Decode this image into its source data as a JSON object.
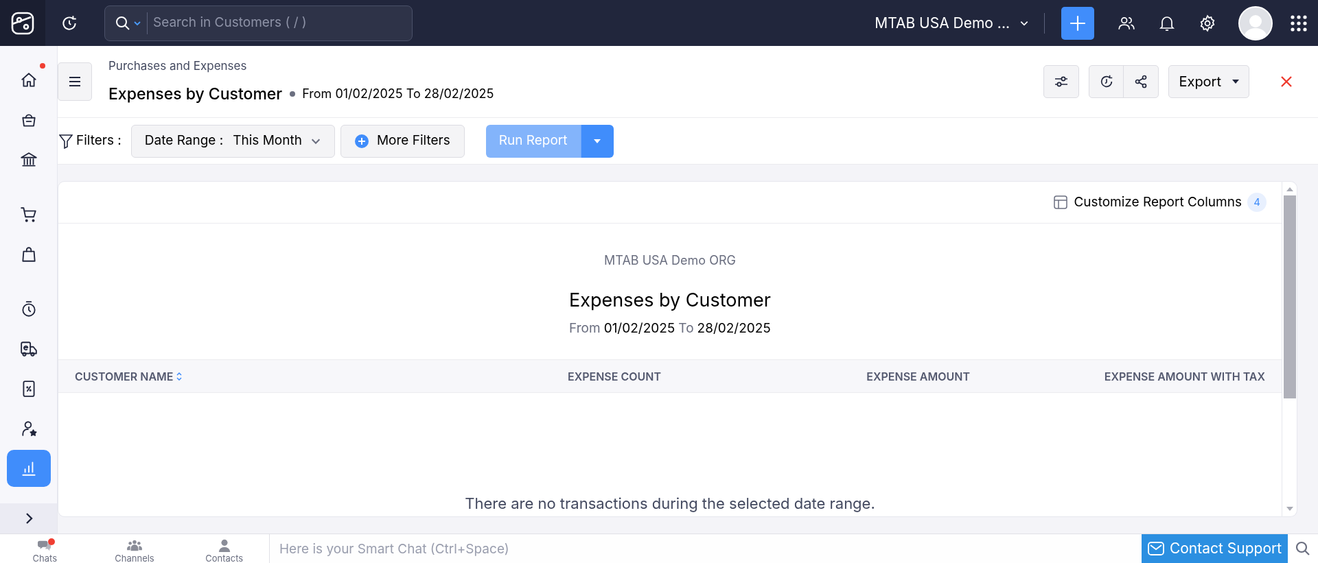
{
  "top_bar": {
    "search": {
      "placeholder": "Search in Customers ( / )"
    },
    "organization": "MTAB USA Demo ..."
  },
  "sidebar": {
    "items": [
      {
        "kind": "home",
        "selected": false,
        "notification": true
      },
      {
        "kind": "basket",
        "selected": false,
        "notification": false
      },
      {
        "kind": "bank",
        "selected": false,
        "notification": false
      },
      {
        "kind": "cart",
        "selected": false,
        "notification": false
      },
      {
        "kind": "bag",
        "selected": false,
        "notification": false
      },
      {
        "kind": "timer",
        "selected": false,
        "notification": false
      },
      {
        "kind": "truck",
        "selected": false,
        "notification": false
      },
      {
        "kind": "percent",
        "selected": false,
        "notification": false
      },
      {
        "kind": "user",
        "selected": false,
        "notification": false
      },
      {
        "kind": "chart",
        "selected": true,
        "notification": false
      }
    ]
  },
  "header": {
    "breadcrumb": "Purchases and Expenses",
    "title": "Expenses by Customer",
    "period": "From 01/02/2025 To 28/02/2025",
    "export_button": "Export"
  },
  "filters": {
    "label": "Filters :",
    "date_range_label": "Date Range :",
    "date_range_value": "This Month",
    "more_filters": "More Filters",
    "run_report": "Run Report"
  },
  "report": {
    "customize_columns": "Customize Report Columns",
    "column_count": "4",
    "organization": "MTAB USA Demo ORG",
    "title": "Expenses by Customer",
    "from_label": "From",
    "from_date": "01/02/2025",
    "to_label": "To",
    "to_date": "28/02/2025",
    "columns": [
      {
        "label": "CUSTOMER NAME",
        "sortable": true
      },
      {
        "label": "EXPENSE COUNT",
        "sortable": false
      },
      {
        "label": "EXPENSE AMOUNT",
        "sortable": false
      },
      {
        "label": "EXPENSE AMOUNT WITH TAX",
        "sortable": false
      }
    ],
    "empty_message": "There are no transactions during the selected date range."
  },
  "bottom_bar": {
    "tabs": [
      {
        "kind": "chats",
        "label": "Chats",
        "notification": true
      },
      {
        "kind": "channels",
        "label": "Channels",
        "notification": false
      },
      {
        "kind": "contacts",
        "label": "Contacts",
        "notification": false
      }
    ],
    "smart_chat": {
      "placeholder": "Here is your Smart Chat (Ctrl+Space)"
    },
    "contact_support": "Contact Support"
  }
}
